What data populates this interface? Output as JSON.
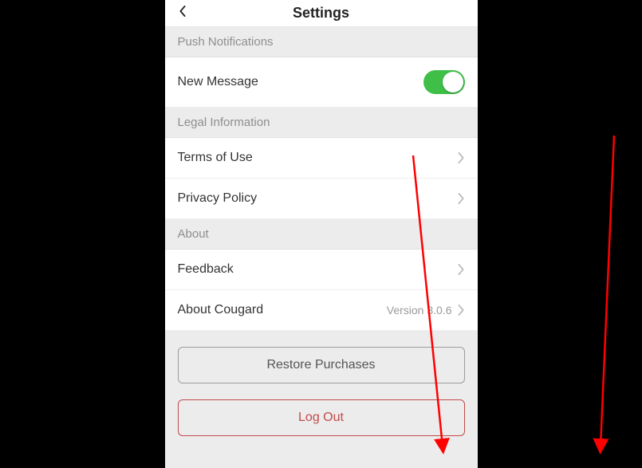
{
  "header": {
    "title": "Settings"
  },
  "sections": {
    "push": {
      "header": "Push Notifications",
      "new_message_label": "New Message",
      "new_message_on": true
    },
    "legal": {
      "header": "Legal Information",
      "terms_label": "Terms of Use",
      "privacy_label": "Privacy Policy"
    },
    "about": {
      "header": "About",
      "feedback_label": "Feedback",
      "about_app_label": "About Cougard",
      "version_label": "Version 3.0.6"
    }
  },
  "buttons": {
    "restore": "Restore Purchases",
    "logout": "Log Out"
  },
  "annotation": {
    "arrow_color": "#ff0000"
  }
}
